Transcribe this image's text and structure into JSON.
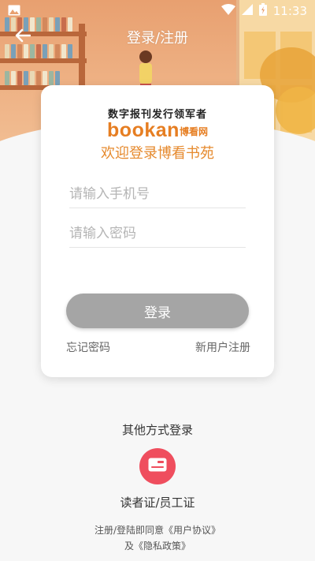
{
  "status_bar": {
    "time": "11:33",
    "icons": [
      "image-icon",
      "wifi-icon",
      "signal-icon",
      "battery-charging-icon"
    ]
  },
  "nav": {
    "title": "登录/注册",
    "back_icon": "arrow-left-icon"
  },
  "login_card": {
    "tagline": "数字报刊发行领军者",
    "brand_en": "bookan",
    "brand_cn": "博看网",
    "welcome": "欢迎登录博看书苑",
    "phone_placeholder": "请输入手机号",
    "password_placeholder": "请输入密码",
    "login_label": "登录",
    "forgot_label": "忘记密码",
    "register_label": "新用户注册"
  },
  "other_login": {
    "title": "其他方式登录",
    "method_label": "读者证/员工证",
    "method_icon": "card-icon"
  },
  "agreement": {
    "prefix": "注册/登陆即同意",
    "user_agreement": "《用户协议》",
    "and": "及",
    "privacy_policy": "《隐私政策》"
  },
  "colors": {
    "brand_orange": "#e67e22",
    "welcome_orange": "#e68a2e",
    "login_button": "#a5a5a5",
    "card_login_button": "#ef4e5e"
  }
}
